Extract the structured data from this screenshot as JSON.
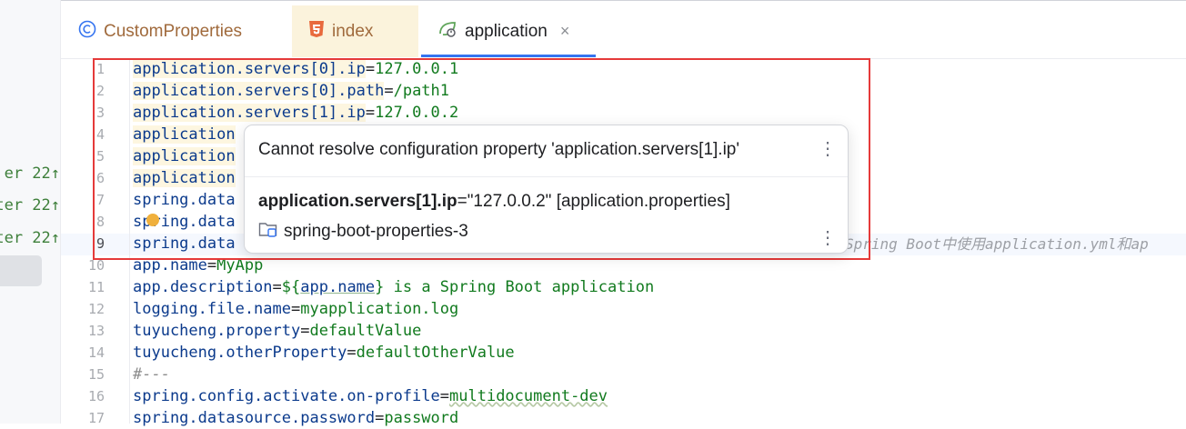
{
  "left_panel": {
    "git_labels": [
      "er 22↑",
      "ter 22↑",
      "ter 22↑"
    ]
  },
  "tabs": [
    {
      "label": "CustomProperties",
      "icon": "class-c-icon"
    },
    {
      "label": "index",
      "icon": "html5-icon"
    },
    {
      "label": "application",
      "icon": "spring-leaf-icon",
      "close": "×"
    }
  ],
  "editor": {
    "line_numbers": [
      "1",
      "2",
      "3",
      "4",
      "5",
      "6",
      "7",
      "8",
      "9",
      "10",
      "11",
      "12",
      "13",
      "14",
      "15",
      "16",
      "17"
    ],
    "lines": {
      "l1": {
        "key": "application.servers[0].ip",
        "eq": "=",
        "val": "127.0.0.1"
      },
      "l2": {
        "key": "application.servers[0].path",
        "eq": "=",
        "val": "/path1"
      },
      "l3": {
        "key": "application.servers[1].ip",
        "eq": "=",
        "val": "127.0.0.2"
      },
      "l4": {
        "key": "application"
      },
      "l5": {
        "key": "application"
      },
      "l6": {
        "key": "application"
      },
      "l7": {
        "key": "spring.data"
      },
      "l8": {
        "key": "spring.data"
      },
      "l9": {
        "key": "spring.data"
      },
      "l10": {
        "key": "app.name",
        "eq": "=",
        "val": "MyApp"
      },
      "l11": {
        "key": "app.description",
        "eq": "=",
        "val1": "${",
        "ref": "app.name",
        "val2": "} is a Spring Boot application"
      },
      "l12": {
        "key": "logging.file.name",
        "eq": "=",
        "val": "myapplication.log"
      },
      "l13": {
        "key": "tuyucheng.property",
        "eq": "=",
        "val": "defaultValue"
      },
      "l14": {
        "key": "tuyucheng.otherProperty",
        "eq": "=",
        "val": "defaultOtherValue"
      },
      "l15": {
        "comment": "#---"
      },
      "l16": {
        "key": "spring.config.activate.on-profile",
        "eq": "=",
        "val": "multidocument-dev"
      },
      "l17": {
        "key": "spring.datasource.password",
        "eq": "=",
        "val": "password"
      }
    },
    "inlay_hint": "Spring Boot中使用application.yml和ap"
  },
  "popup": {
    "message": "Cannot resolve configuration property 'application.servers[1].ip'",
    "prop_key": "application.servers[1].ip",
    "prop_eq": "=",
    "prop_value": "\"127.0.0.2\" [application.properties]",
    "module_name": "spring-boot-properties-3",
    "more_glyph": "⋮"
  },
  "colors": {
    "annotation_box": "#e53a3a",
    "key": "#0b3a8c",
    "value": "#117a1e",
    "tab_underline": "#3574f0"
  }
}
